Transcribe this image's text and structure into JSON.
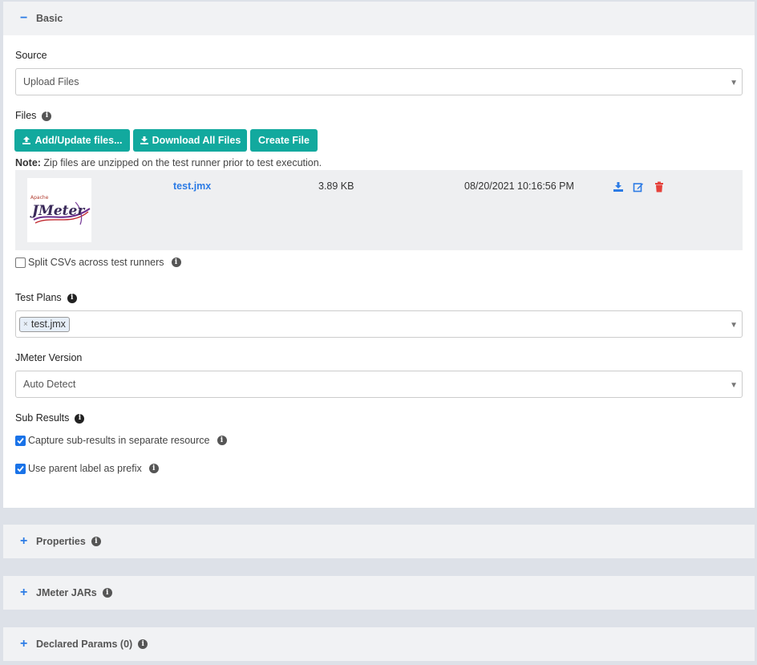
{
  "basic": {
    "title": "Basic",
    "toggle": "−",
    "source": {
      "label": "Source",
      "value": "Upload Files"
    },
    "files": {
      "label": "Files",
      "buttons": {
        "add": "Add/Update files...",
        "download": "Download All Files",
        "create": "Create File"
      },
      "note_bold": "Note:",
      "note_text": " Zip files are unzipped on the test runner prior to test execution.",
      "rows": [
        {
          "name": "test.jmx",
          "size": "3.89 KB",
          "date": "08/20/2021 10:16:56 PM"
        }
      ],
      "logo_small": "Apache",
      "logo_big": "JMeter"
    },
    "split_csv": {
      "label": "Split CSVs across test runners",
      "checked": false
    },
    "test_plans": {
      "label": "Test Plans",
      "tag": "test.jmx",
      "tag_remove": "×"
    },
    "jmeter_version": {
      "label": "JMeter Version",
      "value": "Auto Detect"
    },
    "sub_results": {
      "label": "Sub Results",
      "capture": {
        "label": "Capture sub-results in separate resource",
        "checked": true
      },
      "prefix": {
        "label": "Use parent label as prefix",
        "checked": true
      }
    }
  },
  "collapsed_panels": [
    {
      "title": "Properties",
      "toggle": "+"
    },
    {
      "title": "JMeter JARs",
      "toggle": "+"
    },
    {
      "title": "Declared Params (0)",
      "toggle": "+"
    }
  ],
  "icons": {
    "info": "info-icon",
    "caret": "chevron-down-icon",
    "upload": "upload-icon",
    "download": "download-icon",
    "edit": "edit-icon",
    "delete": "trash-icon"
  },
  "colors": {
    "accent": "#12a99e",
    "link": "#2c7be5",
    "delete": "#e5413b",
    "checkbox": "#1a73e8"
  }
}
